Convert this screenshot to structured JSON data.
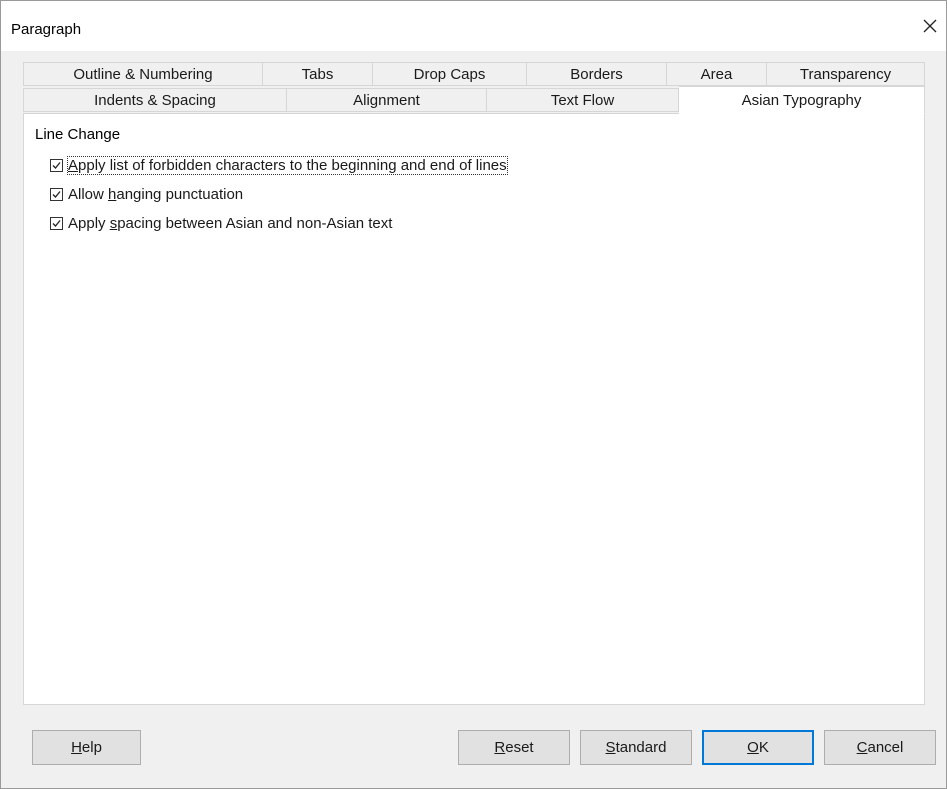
{
  "window": {
    "title": "Paragraph",
    "close_icon": "close-icon"
  },
  "tabs_row1": [
    {
      "label": "Outline & Numbering"
    },
    {
      "label": "Tabs"
    },
    {
      "label": "Drop Caps"
    },
    {
      "label": "Borders"
    },
    {
      "label": "Area"
    },
    {
      "label": "Transparency"
    }
  ],
  "tabs_row2": [
    {
      "label": "Indents & Spacing"
    },
    {
      "label": "Alignment"
    },
    {
      "label": "Text Flow"
    },
    {
      "label": "Asian Typography",
      "active": true
    }
  ],
  "section": {
    "title": "Line Change",
    "options": [
      {
        "pre": "",
        "u": "A",
        "post": "pply list of forbidden characters to the beginning and end of lines",
        "checked": true
      },
      {
        "pre": "Allow ",
        "u": "h",
        "post": "anging punctuation",
        "checked": true
      },
      {
        "pre": "Apply ",
        "u": "s",
        "post": "pacing between Asian and non-Asian text",
        "checked": true
      }
    ]
  },
  "buttons": {
    "help": {
      "pre": "",
      "u": "H",
      "post": "elp"
    },
    "reset": {
      "pre": "",
      "u": "R",
      "post": "eset"
    },
    "standard": {
      "pre": "",
      "u": "S",
      "post": "tandard"
    },
    "ok": {
      "pre": "",
      "u": "O",
      "post": "K"
    },
    "cancel": {
      "pre": "",
      "u": "C",
      "post": "ancel"
    }
  },
  "colors": {
    "accent": "#0078d7",
    "panel_bg": "#ffffff",
    "dialog_bg": "#f0f0f0"
  }
}
